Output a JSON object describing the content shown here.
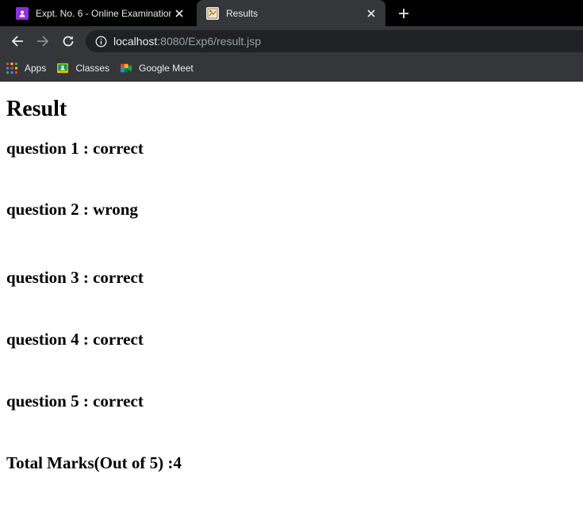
{
  "tabs": [
    {
      "title": "Expt. No. 6 - Online Examination",
      "favicon": "classroom-icon",
      "active": false
    },
    {
      "title": "Results",
      "favicon": "results-page-icon",
      "active": true
    }
  ],
  "omnibox": {
    "host": "localhost",
    "rest": ":8080/Exp6/result.jsp"
  },
  "bookmarks": [
    {
      "label": "Apps",
      "icon": "apps-grid-icon"
    },
    {
      "label": "Classes",
      "icon": "classroom-icon"
    },
    {
      "label": "Google Meet",
      "icon": "google-meet-icon"
    }
  ],
  "page": {
    "heading": "Result",
    "results": [
      "question 1 : correct",
      "question 2 : wrong",
      "question 3 : correct",
      "question 4 : correct",
      "question 5 : correct"
    ],
    "total": "Total Marks(Out of 5) :4"
  },
  "colors": {
    "tabstrip": "#000000",
    "toolbar": "#35363a",
    "omnibox": "#202124",
    "text_light": "#e8eaed"
  }
}
